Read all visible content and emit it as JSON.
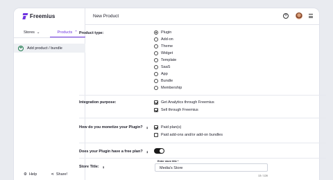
{
  "brand": {
    "name": "Freemius"
  },
  "sidebar": {
    "tabs": [
      {
        "label": "Stores",
        "chevron": "⌄",
        "active": false
      },
      {
        "label": "Products",
        "chevron": "⌃",
        "active": true
      }
    ],
    "add_label": "Add product / bundle",
    "footer": {
      "help_label": "Help",
      "share_label": "Share!"
    }
  },
  "header": {
    "title": "New Product"
  },
  "form": {
    "product_type": {
      "label": "Product type:",
      "options": [
        {
          "label": "Plugin",
          "selected": true
        },
        {
          "label": "Add-on",
          "selected": false
        },
        {
          "label": "Theme",
          "selected": false
        },
        {
          "label": "Widget",
          "selected": false
        },
        {
          "label": "Template",
          "selected": false
        },
        {
          "label": "SaaS",
          "selected": false
        },
        {
          "label": "App",
          "selected": false
        },
        {
          "label": "Bundle",
          "selected": false
        },
        {
          "label": "Membership",
          "selected": false
        }
      ]
    },
    "integration": {
      "label": "Integration purpose:",
      "options": [
        {
          "label": "Get Analytics through Freemius",
          "checked": true
        },
        {
          "label": "Sell through Freemius",
          "checked": true
        }
      ]
    },
    "monetize": {
      "label": "How do you monetize your Plugin?",
      "options": [
        {
          "label": "Paid plan(s)",
          "checked": true
        },
        {
          "label": "Paid add-ons and/or add-on bundles",
          "checked": false
        }
      ]
    },
    "free_plan": {
      "label": "Does your Plugin have a free plan?",
      "enabled": true
    },
    "store_title": {
      "label": "Store Title:",
      "field_label": "Enter store title *",
      "value": "Media's Store",
      "counter": "13 / 128"
    }
  }
}
